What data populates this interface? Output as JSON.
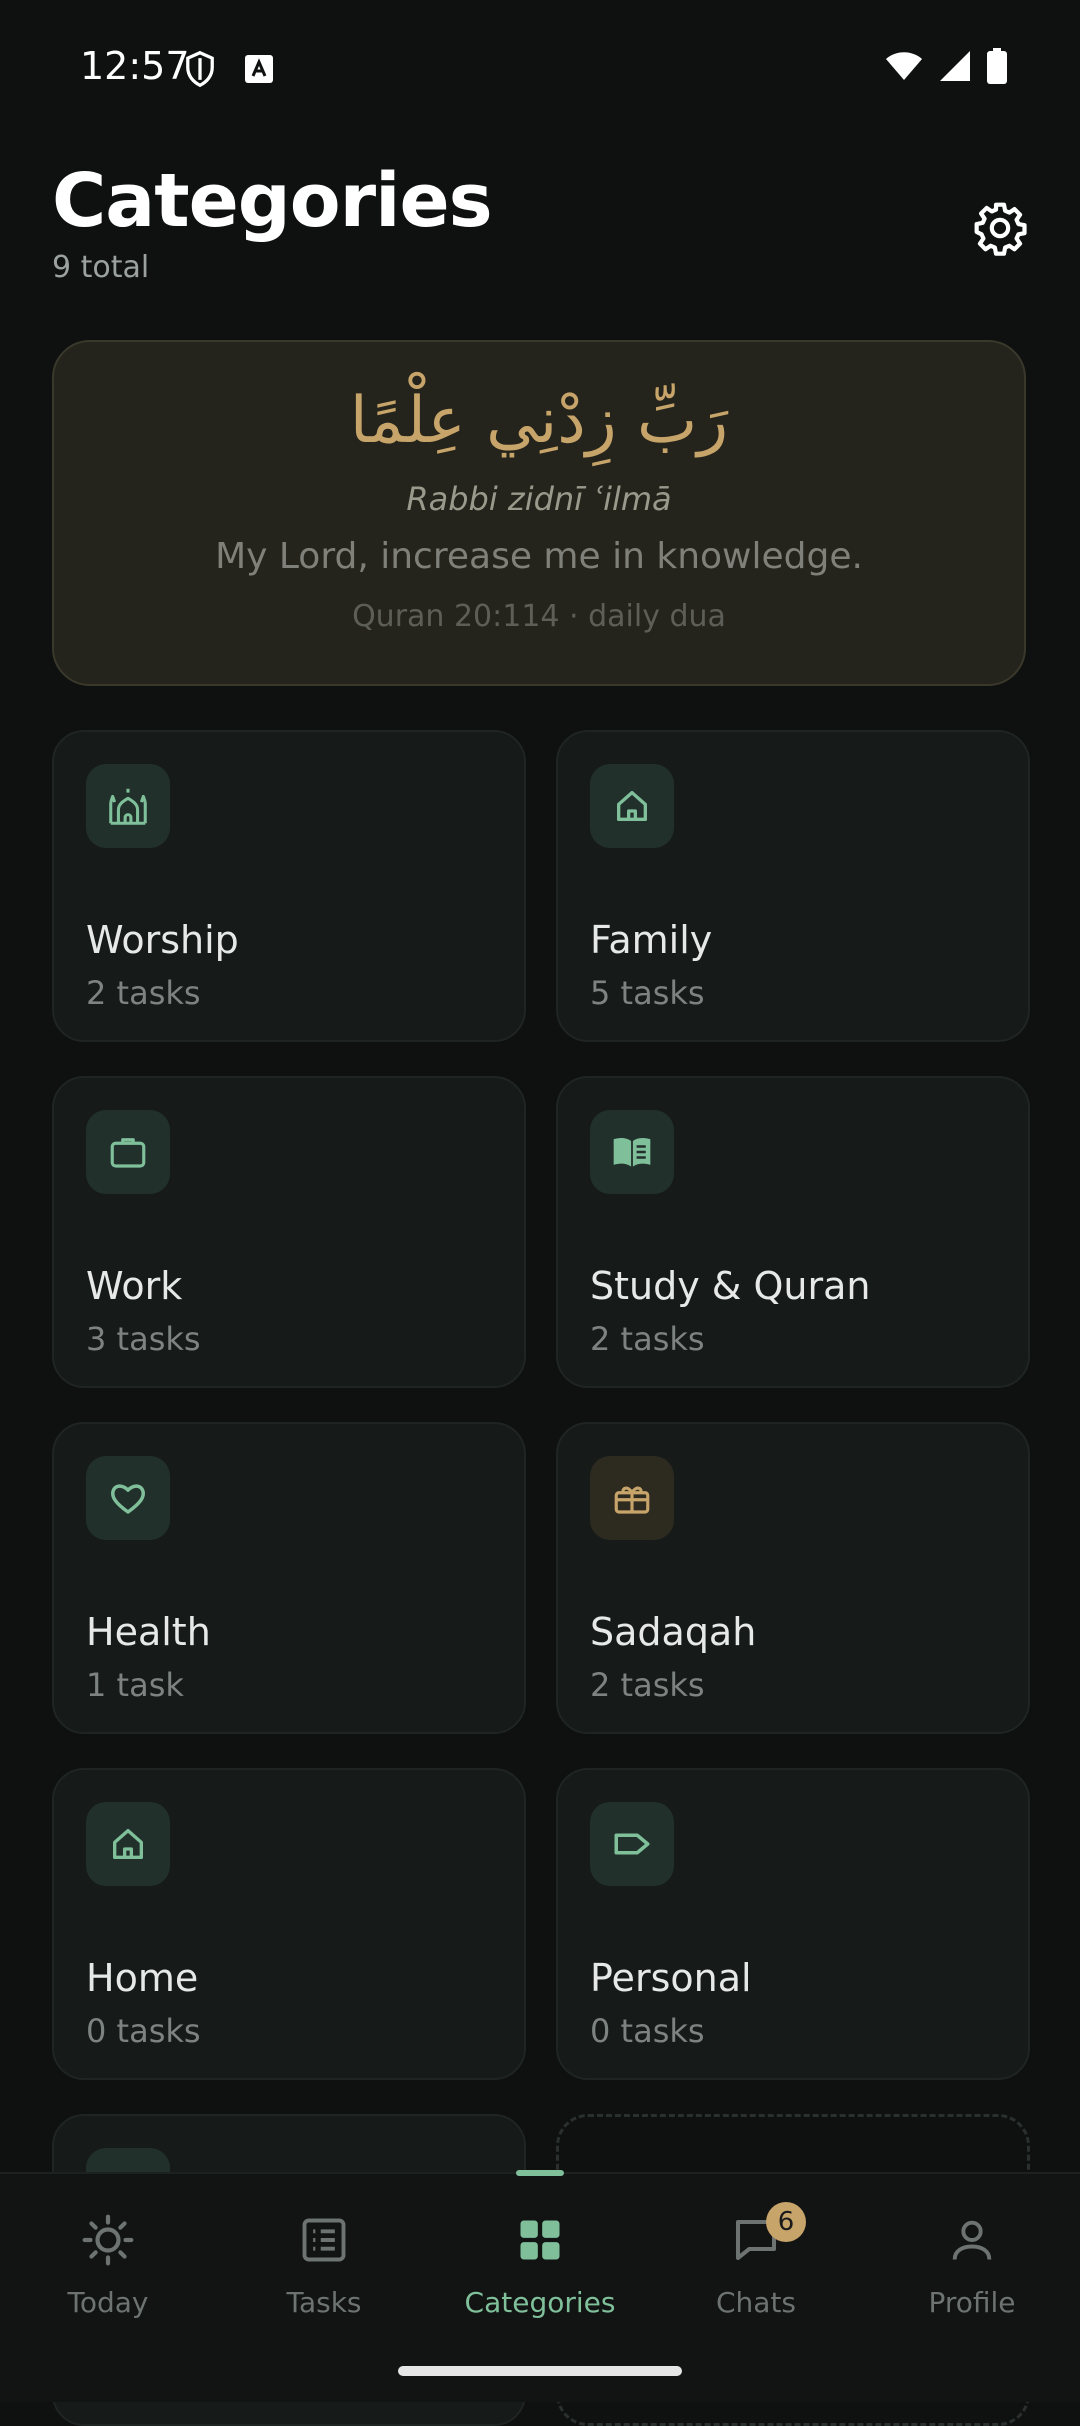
{
  "status": {
    "time": "12:57"
  },
  "header": {
    "title": "Categories",
    "subtitle": "9 total"
  },
  "dua": {
    "arabic": "رَبِّ زِدْنِي عِلْمًا",
    "transliteration": "Rabbi zidnī ʿilmā",
    "meaning": "My Lord, increase me in knowledge.",
    "source": "Quran 20:114 · daily dua"
  },
  "categories": [
    {
      "name": "Worship",
      "count": "2 tasks",
      "icon": "mosque-icon"
    },
    {
      "name": "Family",
      "count": "5 tasks",
      "icon": "house-icon"
    },
    {
      "name": "Work",
      "count": "3 tasks",
      "icon": "briefcase-icon"
    },
    {
      "name": "Study & Quran",
      "count": "2 tasks",
      "icon": "book-icon"
    },
    {
      "name": "Health",
      "count": "1 task",
      "icon": "heart-icon"
    },
    {
      "name": "Sadaqah",
      "count": "2 tasks",
      "icon": "gift-icon"
    },
    {
      "name": "Home",
      "count": "0 tasks",
      "icon": "house-icon"
    },
    {
      "name": "Personal",
      "count": "0 tasks",
      "icon": "tag-icon"
    }
  ],
  "nav": {
    "items": [
      {
        "label": "Today",
        "icon": "sun-icon"
      },
      {
        "label": "Tasks",
        "icon": "list-icon"
      },
      {
        "label": "Categories",
        "icon": "grid-icon"
      },
      {
        "label": "Chats",
        "icon": "chat-icon"
      },
      {
        "label": "Profile",
        "icon": "person-icon"
      }
    ],
    "active": "Categories",
    "chats_badge": "6"
  },
  "colors": {
    "accent": "#7fbf9a",
    "gold": "#c7a46a",
    "background": "#0e1110"
  }
}
